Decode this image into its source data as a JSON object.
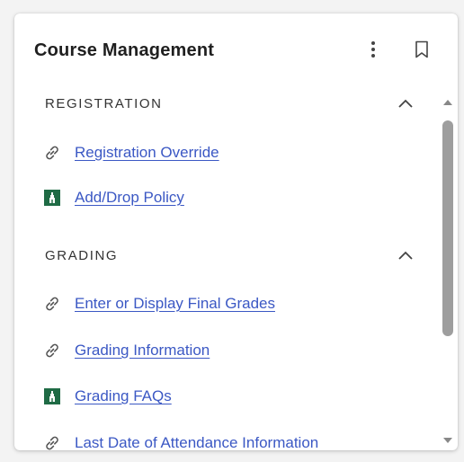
{
  "card": {
    "title": "Course Management",
    "more_icon": "more-vert-icon",
    "bookmark_icon": "bookmark-icon"
  },
  "sections": [
    {
      "title": "REGISTRATION",
      "expanded": true,
      "links": [
        {
          "label": "Registration Override",
          "icon": "link-icon"
        },
        {
          "label": "Add/Drop Policy",
          "icon": "campus-logo-icon"
        }
      ]
    },
    {
      "title": "GRADING",
      "expanded": true,
      "links": [
        {
          "label": "Enter or Display Final Grades",
          "icon": "link-icon"
        },
        {
          "label": "Grading Information",
          "icon": "link-icon"
        },
        {
          "label": "Grading FAQs",
          "icon": "campus-logo-icon"
        },
        {
          "label": "Last Date of Attendance Information",
          "icon": "link-icon"
        }
      ]
    }
  ],
  "colors": {
    "link": "#3b58c4",
    "logo_green": "#1f6b45",
    "scroll_thumb": "#9e9e9e"
  }
}
